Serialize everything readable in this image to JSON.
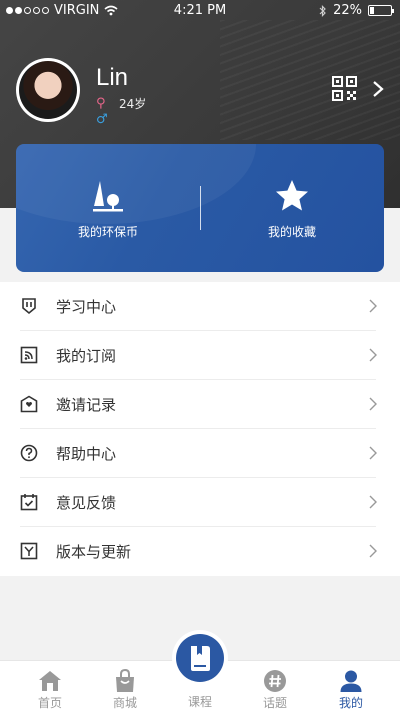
{
  "status_bar": {
    "carrier": "VIRGIN",
    "time": "4:21 PM",
    "battery": "22%",
    "battery_level": 0.22
  },
  "profile": {
    "name": "Lin",
    "age": "24岁"
  },
  "card": {
    "eco_coins": "我的环保币",
    "favorites": "我的收藏"
  },
  "menu": [
    {
      "label": "学习中心",
      "icon": "badge-icon"
    },
    {
      "label": "我的订阅",
      "icon": "rss-icon"
    },
    {
      "label": "邀请记录",
      "icon": "invite-icon"
    },
    {
      "label": "帮助中心",
      "icon": "help-icon"
    },
    {
      "label": "意见反馈",
      "icon": "feedback-icon"
    },
    {
      "label": "版本与更新",
      "icon": "update-icon"
    }
  ],
  "tabs": {
    "home": "首页",
    "mall": "商城",
    "course": "课程",
    "topic": "话题",
    "mine": "我的"
  },
  "colors": {
    "accent": "#2b58a3",
    "header": "#3d3d3d"
  }
}
